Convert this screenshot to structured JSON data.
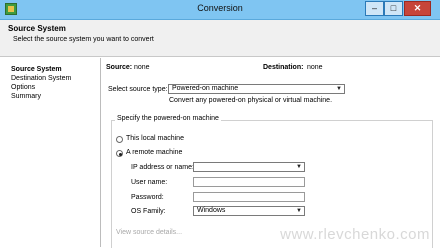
{
  "window": {
    "title": "Conversion",
    "min_glyph": "–",
    "max_glyph": "□",
    "close_glyph": "✕"
  },
  "header": {
    "title": "Source System",
    "subtitle": "Select the source system you want to convert"
  },
  "sidebar": {
    "items": [
      {
        "label": "Source System"
      },
      {
        "label": "Destination System"
      },
      {
        "label": "Options"
      },
      {
        "label": "Summary"
      }
    ]
  },
  "summary": {
    "source_label": "Source:",
    "source_value": "none",
    "destination_label": "Destination:",
    "destination_value": "none"
  },
  "source_type": {
    "label": "Select source type:",
    "value": "Powered-on machine",
    "hint": "Convert any powered-on physical or virtual machine."
  },
  "group": {
    "title": "Specify the powered-on machine",
    "local_label": "This local machine",
    "remote_label": "A remote machine",
    "ip_label": "IP address or name:",
    "ip_value": "",
    "user_label": "User name:",
    "password_label": "Password:",
    "os_label": "OS Family:",
    "os_value": "Windows",
    "details_link": "View source details..."
  },
  "watermark": "www.rlevchenko.com"
}
